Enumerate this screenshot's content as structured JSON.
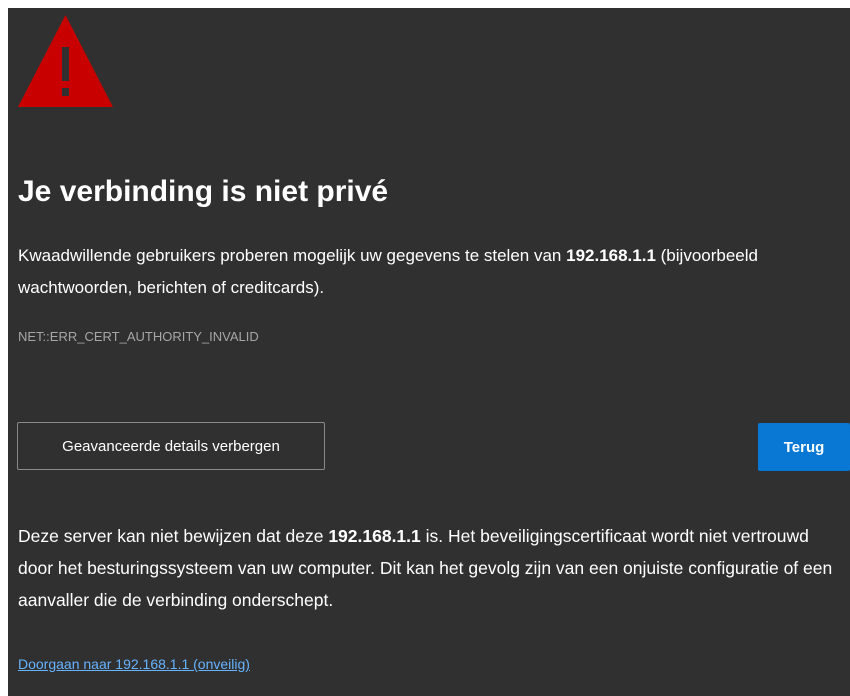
{
  "title": "Je verbinding is niet privé",
  "description": {
    "before": "Kwaadwillende gebruikers proberen mogelijk uw gegevens te stelen van ",
    "host": "192.168.1.1",
    "after": " (bijvoorbeeld wachtwoorden, berichten of creditcards)."
  },
  "error_code": "NET::ERR_CERT_AUTHORITY_INVALID",
  "buttons": {
    "details_label": "Geavanceerde details verbergen",
    "back_label": "Terug"
  },
  "details": {
    "before": "Deze server kan niet bewijzen dat deze ",
    "host": "192.168.1.1",
    "after": " is. Het beveiligingscertificaat wordt niet vertrouwd door het besturingssysteem van uw computer. Dit kan het gevolg zijn van een onjuiste configuratie of een aanvaller die de verbinding onderschept."
  },
  "proceed_link": "Doorgaan naar 192.168.1.1 (onveilig)",
  "colors": {
    "background": "#303030",
    "warning_icon": "#c80000",
    "primary_button": "#0878d4",
    "link": "#66b3ff",
    "error_code_text": "#a6a6a6"
  },
  "icons": {
    "warning": "warning-triangle-icon"
  }
}
